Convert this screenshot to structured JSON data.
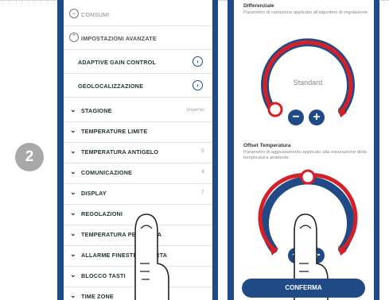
{
  "step_number": "2",
  "left_menu": {
    "consumi": "CONSUMI",
    "advanced": "IMPOSTAZIONI AVANZATE",
    "adaptive": "ADAPTIVE GAIN CONTROL",
    "geo": "GEOLOCALIZZAZIONE",
    "items": [
      {
        "label": "STAGIONE",
        "value": "inverno"
      },
      {
        "label": "TEMPERATURE LIMITE",
        "value": ""
      },
      {
        "label": "TEMPERATURA ANTIGELO",
        "value": "5"
      },
      {
        "label": "COMUNICAZIONE",
        "value": "4"
      },
      {
        "label": "DISPLAY",
        "value": "7"
      },
      {
        "label": "REGOLAZIONI",
        "value": ""
      },
      {
        "label": "TEMPERATURA PERCEPITA",
        "value": ""
      },
      {
        "label": "ALLARME FINESTRA APERTA",
        "value": ""
      },
      {
        "label": "BLOCCO TASTI",
        "value": ""
      },
      {
        "label": "TIME ZONE",
        "value": ""
      }
    ]
  },
  "right": {
    "diff_title": "Differenziale",
    "diff_desc": "Parametro di variazione applicato all'algoritmo di regolazione.",
    "dial1_value": "Standard",
    "offset_title": "Offset Temperatura",
    "offset_desc": "Parametro di aggiustamento applicato alla misurazione della temperatura ambiente.",
    "confirm": "CONFERMA",
    "minus": "−",
    "plus": "+"
  },
  "colors": {
    "brand": "#1f4a86",
    "accent": "#d62027"
  }
}
